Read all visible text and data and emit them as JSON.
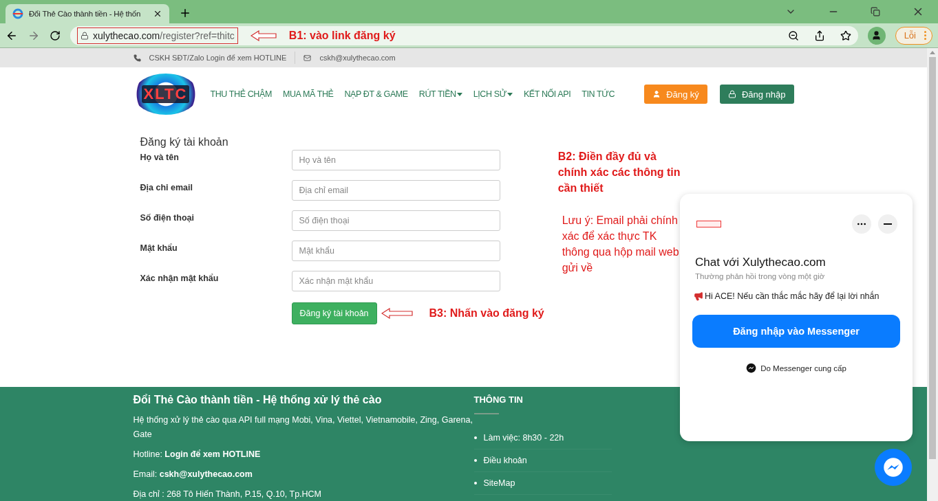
{
  "browser": {
    "tab_title": "Đổi Thẻ Cào thành tiền - Hệ thốn",
    "url_host": "xulythecao.com",
    "url_path": "/register?ref=thitc",
    "profile_button": "Lỗi"
  },
  "top_bar": {
    "phone": "CSKH SĐT/Zalo Login để xem HOTLINE",
    "email": "cskh@xulythecao.com"
  },
  "header": {
    "logo": "XLTC",
    "nav": [
      {
        "label": "THU THẺ CHẬM",
        "dropdown": false
      },
      {
        "label": "MUA MÃ THẺ",
        "dropdown": false
      },
      {
        "label": "NẠP ĐT & GAME",
        "dropdown": false
      },
      {
        "label": "RÚT TIỀN",
        "dropdown": true
      },
      {
        "label": "LỊCH SỬ",
        "dropdown": true
      },
      {
        "label": "KẾT NỐI API",
        "dropdown": false
      },
      {
        "label": "TIN TỨC",
        "dropdown": false
      }
    ],
    "register": "Đăng ký",
    "login": "Đăng nhập"
  },
  "form": {
    "title": "Đăng ký tài khoản",
    "fields": [
      {
        "label": "Họ và tên",
        "placeholder": "Họ và tên"
      },
      {
        "label": "Địa chỉ email",
        "placeholder": "Địa chỉ email"
      },
      {
        "label": "Số điện thoại",
        "placeholder": "Số điện thoại"
      },
      {
        "label": "Mật khẩu",
        "placeholder": "Mật khẩu"
      },
      {
        "label": "Xác nhận mật khẩu",
        "placeholder": "Xác nhận mật khẩu"
      }
    ],
    "submit": "Đăng ký tài khoản"
  },
  "annotations": {
    "step1": "B1: vào link đăng ký",
    "step2": "B2: Điền đầy đủ và chính xác các thông tin cần thiết",
    "note": "Lưu ý: Email phải chính xác để xác thực TK thông qua hộp mail web gửi về",
    "step3": "B3: Nhấn vào đăng ký"
  },
  "footer": {
    "title": "Đổi Thẻ Cào thành tiền - Hệ thống xử lý thẻ cào",
    "description": "Hệ thống xử lý thẻ cào qua API full mạng Mobi, Vina, Viettel, Vietnamobile, Zing, Garena, Gate",
    "hotline": "Hotline: **Login để xem HOTLINE**",
    "email": "Email: **cskh@xulythecao.com**",
    "address": "Địa chỉ : 268 Tô Hiến Thành, P.15, Q.10, Tp.HCM",
    "info_title": "THÔNG TIN",
    "info_items": [
      "Làm việc: 8h30 - 22h",
      "Điều khoản",
      "SiteMap"
    ]
  },
  "chat": {
    "title": "Chat với Xulythecao.com",
    "subtitle": "Thường phản hồi trong vòng một giờ",
    "greeting": "Hi ACE! Nếu cần thắc mắc hãy để lại lời nhắn",
    "button": "Đăng nhập vào Messenger",
    "powered_by": "Do Messenger cung cấp"
  }
}
